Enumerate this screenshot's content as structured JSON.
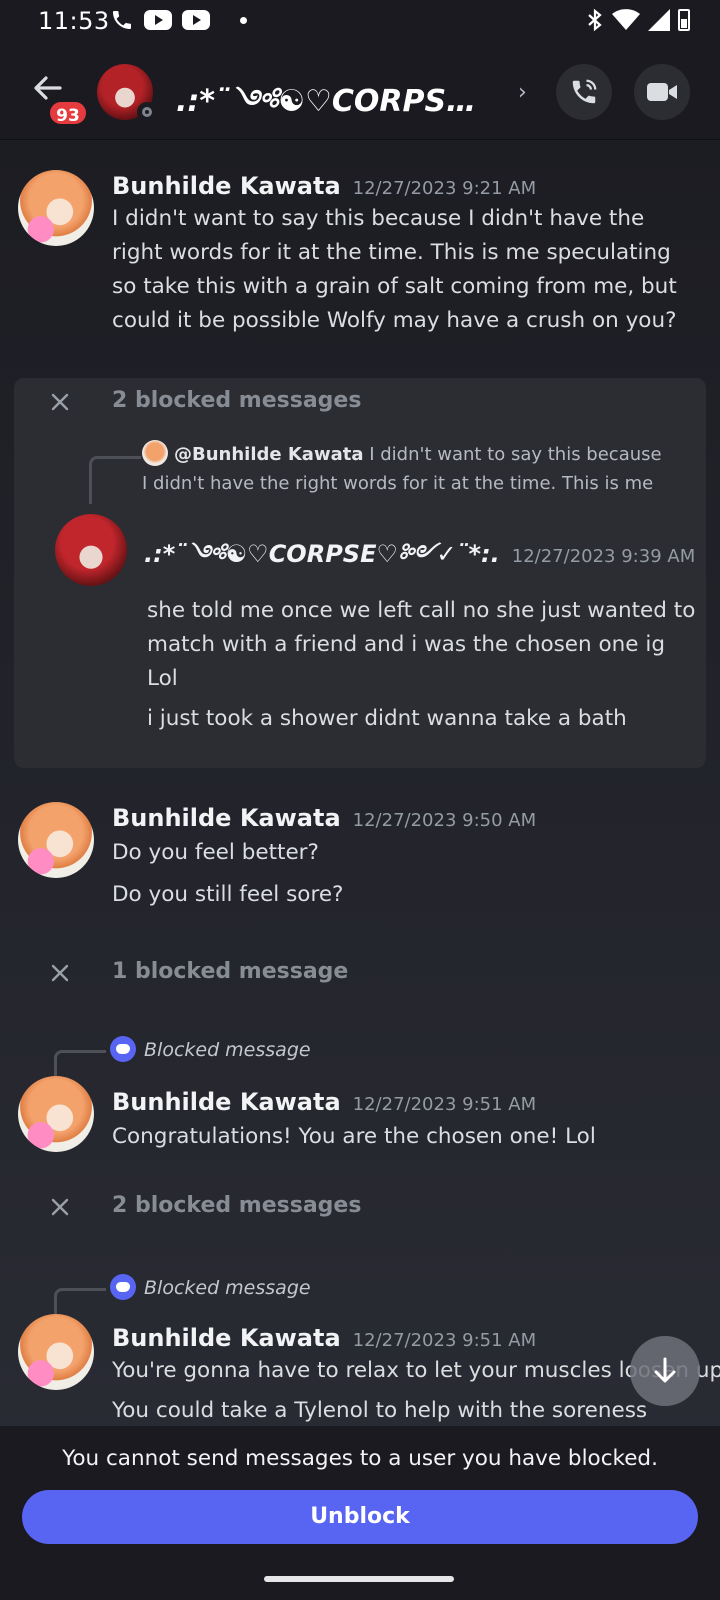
{
  "status_bar": {
    "time": "11:53"
  },
  "header": {
    "title": ".:*¨༺☯︎♡CORPSE♡...",
    "unread_badge": "93",
    "chevron": "›"
  },
  "messages": [
    {
      "author": "Bunhilde Kawata",
      "timestamp": "12/27/2023 9:21 AM",
      "text": "I didn't want to say this because I didn't have the right words for it at the time. This is me speculating so take this with a grain of salt coming from me, but could it be possible Wolfy may have a crush on you?"
    }
  ],
  "blocked_group_1": {
    "label": "2 blocked messages",
    "reply_ref": {
      "mention": "@Bunhilde Kawata",
      "text_line1": " I didn't want to say this because",
      "text_line2": "I didn't have the right words for it at the time. This is me"
    },
    "author": ".:*¨༺☯︎♡CORPSE♡༻✓¨*:.",
    "timestamp": "12/27/2023 9:39 AM",
    "lines": [
      "she told me once we left call no she just wanted to",
      "match with a friend and i was the chosen one ig",
      "Lol",
      "i just took a shower didnt wanna take a bath"
    ]
  },
  "message_2": {
    "author": "Bunhilde Kawata",
    "timestamp": "12/27/2023 9:50 AM",
    "lines": [
      "Do you feel better?",
      "Do you still feel sore?"
    ]
  },
  "blocked_group_2": {
    "label": "1 blocked message"
  },
  "message_3": {
    "reply_label": "Blocked message",
    "author": "Bunhilde Kawata",
    "timestamp": "12/27/2023 9:51 AM",
    "lines": [
      "Congratulations! You are the chosen one! Lol"
    ]
  },
  "blocked_group_3": {
    "label": "2 blocked messages"
  },
  "message_4": {
    "reply_label": "Blocked message",
    "author": "Bunhilde Kawata",
    "timestamp": "12/27/2023 9:51 AM",
    "lines": [
      "You're gonna have to relax to let your muscles loosen up",
      "You could take a Tylenol to help with the soreness"
    ]
  },
  "footer": {
    "note": "You cannot send messages to a user you have blocked.",
    "unblock_label": "Unblock"
  },
  "colors": {
    "accent": "#5865f2",
    "badge": "#e63b3e",
    "panel": "#2c2d32"
  },
  "icons": [
    "back-arrow-icon",
    "phone-icon",
    "video-camera-icon",
    "close-icon",
    "discord-icon",
    "arrow-down-icon"
  ]
}
